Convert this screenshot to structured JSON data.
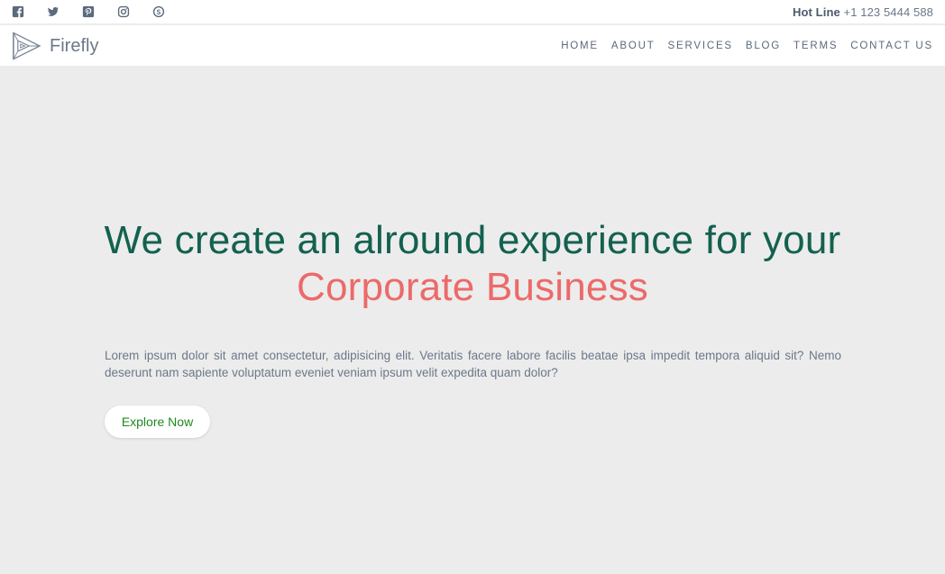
{
  "topbar": {
    "social_icons": [
      "facebook-icon",
      "twitter-icon",
      "pinterest-icon",
      "instagram-icon",
      "skype-icon"
    ],
    "hotline_label": "Hot Line",
    "hotline_number": "+1 123 5444 588"
  },
  "nav": {
    "brand": "Firefly",
    "items": [
      {
        "label": "HOME"
      },
      {
        "label": "ABOUT"
      },
      {
        "label": "SERVICES"
      },
      {
        "label": "BLOG"
      },
      {
        "label": "TERMS"
      },
      {
        "label": "CONTACT US"
      }
    ]
  },
  "hero": {
    "headline_line1": "We create an alround experience for your",
    "headline_line2": "Corporate Business",
    "lead": "Lorem ipsum dolor sit amet consectetur, adipisicing elit. Veritatis facere labore facilis beatae ipsa impedit tempora aliquid sit? Nemo deserunt nam sapiente voluptatum eveniet veniam ipsum velit expedita quam dolor?",
    "cta_label": "Explore Now"
  },
  "colors": {
    "background": "#ececec",
    "headline": "#13614f",
    "accent": "#ec6a6a",
    "cta_text": "#1e8a1e"
  }
}
